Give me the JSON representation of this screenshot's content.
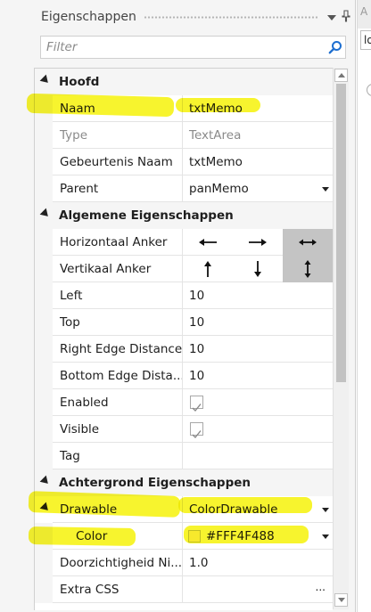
{
  "panel": {
    "title": "Eigenschappen",
    "filter_placeholder": "Filter"
  },
  "right_pane": {
    "tab_text": "A",
    "field_text": "lo"
  },
  "categories": {
    "hoofd": "Hoofd",
    "algemeen": "Algemene Eigenschappen",
    "achtergrond": "Achtergrond Eigenschappen"
  },
  "properties": {
    "naam": {
      "name": "Naam",
      "value": "txtMemo"
    },
    "type": {
      "name": "Type",
      "value": "TextArea"
    },
    "gebeurtenis_naam": {
      "name": "Gebeurtenis Naam",
      "value": "txtMemo"
    },
    "parent": {
      "name": "Parent",
      "value": "panMemo"
    },
    "horizontaal_anker": {
      "name": "Horizontaal Anker",
      "selected": "both"
    },
    "vertikaal_anker": {
      "name": "Vertikaal Anker",
      "selected": "both"
    },
    "left": {
      "name": "Left",
      "value": "10"
    },
    "top": {
      "name": "Top",
      "value": "10"
    },
    "right_edge_distance": {
      "name": "Right Edge Distance",
      "value": "10"
    },
    "bottom_edge_distance": {
      "name": "Bottom Edge Dista...",
      "value": "10"
    },
    "enabled": {
      "name": "Enabled",
      "checked": true
    },
    "visible": {
      "name": "Visible",
      "checked": true
    },
    "tag": {
      "name": "Tag",
      "value": ""
    },
    "drawable": {
      "name": "Drawable",
      "value": "ColorDrawable"
    },
    "color": {
      "name": "Color",
      "value": "#FFF4F488",
      "swatch": "#fff4f4"
    },
    "doorzichtigheid": {
      "name": "Doorzichtigheid Ni...",
      "value": "1.0"
    },
    "extra_css": {
      "name": "Extra CSS",
      "value": "",
      "button": "..."
    }
  },
  "colors": {
    "highlight": "#f5f200",
    "selected_anchor": "#c4c4c4",
    "search_icon": "#1e6fd0"
  }
}
